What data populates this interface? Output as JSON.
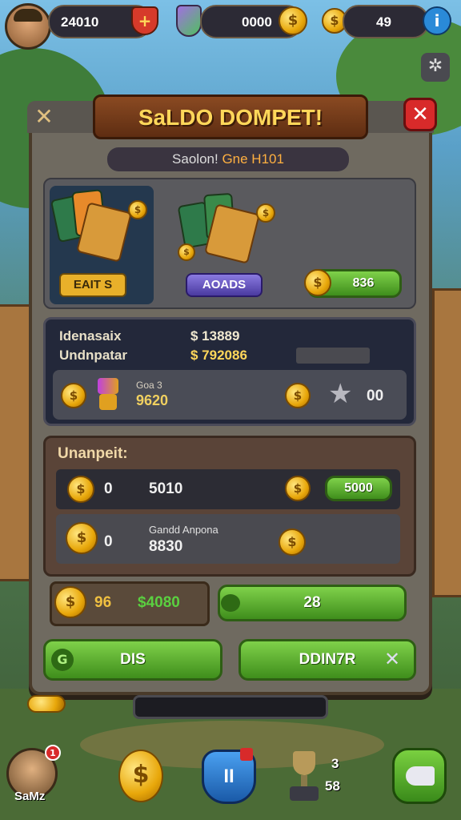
{
  "topbar": {
    "player_value": "24010",
    "gem_value": "0000",
    "coin_value": "49"
  },
  "dialog": {
    "title": "SaLDO DOMPET!",
    "subtitle_main": "Saolon! ",
    "subtitle_accent": "Gne H101"
  },
  "rewards": {
    "pack1_button": "EAIT S",
    "pack2_button": "AOADS",
    "coin_button_value": "836"
  },
  "stats": {
    "row1_label": "Idenasaix",
    "row1_value": "$ 13889",
    "row2_label": "Undnpatar",
    "row2_value": "$ 792086",
    "item_title": "Goa 3",
    "item_value": "9620",
    "star_value": "00"
  },
  "transactions": {
    "header": "Unanpeit:",
    "row1_count": "0",
    "row1_amount": "5010",
    "row1_button": "5000",
    "row2_count": "0",
    "row2_label": "Gandd Anpona",
    "row2_amount": "8830"
  },
  "total": {
    "count": "96",
    "amount": "$4080",
    "button_value": "28"
  },
  "actions": {
    "left_button": "DIS",
    "right_button": "DDIN7R"
  },
  "bottom": {
    "avatar_label": "SaMz",
    "badge_count": "1",
    "shield_label": "II",
    "trophy_count": "3",
    "trophy_value": "58"
  }
}
